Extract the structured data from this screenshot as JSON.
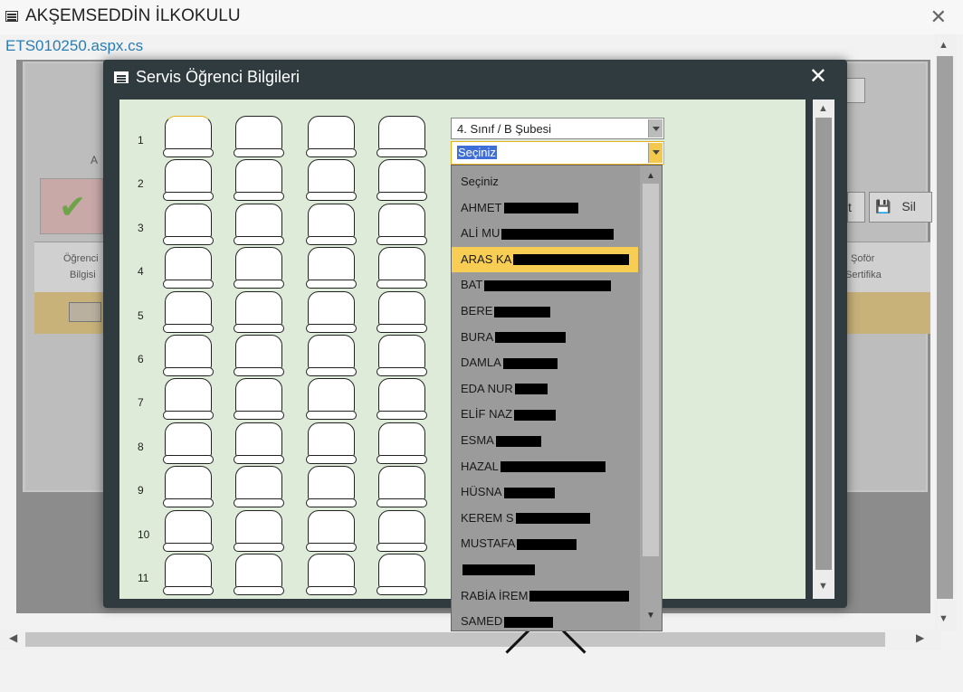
{
  "window": {
    "title": "AKŞEMSEDDİN İLKOKULU",
    "close": "✕"
  },
  "page": {
    "url": "ETS010250.aspx.cs"
  },
  "background": {
    "header_col1_line1": "Öğrenci",
    "header_col1_line2": "Bilgisi",
    "header_col_last_line1": "Şoför",
    "header_col_last_line2": "Sertifika",
    "left_letter": "A",
    "btn_partial": "t",
    "delete_label": "Sil",
    "save_glyph": "💾"
  },
  "modal": {
    "title": "Servis Öğrenci Bilgileri",
    "close": "✕",
    "rows": [
      "1",
      "2",
      "3",
      "4",
      "5",
      "6",
      "7",
      "8",
      "9",
      "10",
      "11"
    ],
    "class_select": {
      "value": "4. Sınıf / B Şubesi"
    },
    "student_select": {
      "value": "Seçiniz"
    }
  },
  "dropdown": {
    "options": [
      {
        "text": "Seçiniz",
        "redact": 0
      },
      {
        "text": "AHMET",
        "redact": 82
      },
      {
        "text": "ALİ MU",
        "redact": 124
      },
      {
        "text": "ARAS KA",
        "redact": 128
      },
      {
        "text": "BAT",
        "redact": 140
      },
      {
        "text": "BERE",
        "redact": 62
      },
      {
        "text": "BURA",
        "redact": 78
      },
      {
        "text": "DAMLA",
        "redact": 60
      },
      {
        "text": "EDA NUR",
        "redact": 36
      },
      {
        "text": "ELİF NAZ",
        "redact": 46
      },
      {
        "text": "ESMA",
        "redact": 50
      },
      {
        "text": "HAZAL",
        "redact": 116
      },
      {
        "text": "HÜSNA",
        "redact": 56
      },
      {
        "text": "KEREM S",
        "redact": 82
      },
      {
        "text": "MUSTAFA",
        "redact": 66
      },
      {
        "text": "",
        "redact": 80
      },
      {
        "text": "RABİA İREM",
        "redact": 110
      },
      {
        "text": "SAMED",
        "redact": 54
      }
    ],
    "highlighted_index": 3
  },
  "colors": {
    "highlight": "#f7cd54",
    "modal_bg": "#2f3b3e",
    "body_bg": "#ddebd8",
    "link": "#2a7db3"
  }
}
